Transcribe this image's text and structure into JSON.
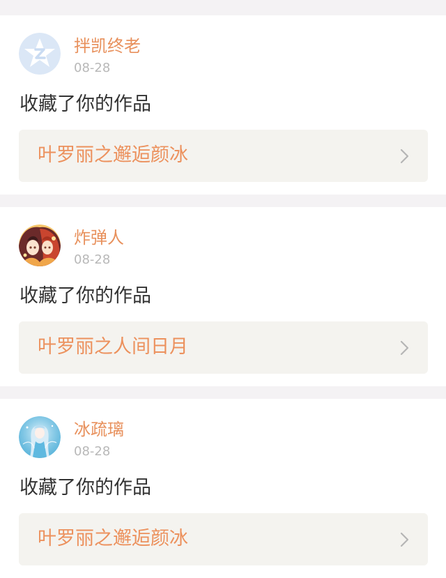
{
  "notifications": [
    {
      "username": "拌凯终老",
      "date": "08-28",
      "action": "收藏了你的作品",
      "work_title": "叶罗丽之邂逅颜冰",
      "avatar_icon": "default-star-avatar-icon"
    },
    {
      "username": "炸弹人",
      "date": "08-28",
      "action": "收藏了你的作品",
      "work_title": "叶罗丽之人间日月",
      "avatar_icon": "anime-girls-avatar"
    },
    {
      "username": "冰疏璃",
      "date": "08-28",
      "action": "收藏了你的作品",
      "work_title": "叶罗丽之邂逅颜冰",
      "avatar_icon": "anime-ice-fairy-avatar"
    }
  ],
  "colors": {
    "accent": "#e8915d",
    "page_bg": "#f4f2f4",
    "card_bg": "#ffffff",
    "link_bg": "#f4f3ef",
    "date": "#b8b8b8",
    "text": "#333333"
  }
}
